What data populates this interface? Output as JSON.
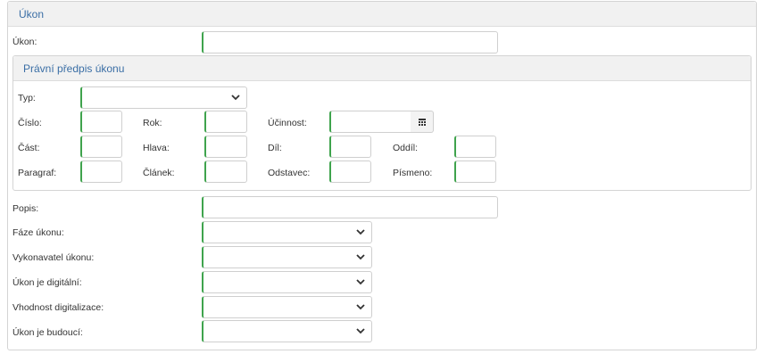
{
  "panel": {
    "title": "Úkon"
  },
  "ukon": {
    "label": "Úkon:",
    "value": ""
  },
  "pravni_predpis": {
    "title": "Právní předpis úkonu",
    "typ": {
      "label": "Typ:",
      "value": ""
    },
    "cislo": {
      "label": "Číslo:",
      "value": ""
    },
    "rok": {
      "label": "Rok:",
      "value": ""
    },
    "ucinnost": {
      "label": "Účinnost:",
      "value": ""
    },
    "cast": {
      "label": "Část:",
      "value": ""
    },
    "hlava": {
      "label": "Hlava:",
      "value": ""
    },
    "dil": {
      "label": "Díl:",
      "value": ""
    },
    "oddil": {
      "label": "Oddíl:",
      "value": ""
    },
    "paragraf": {
      "label": "Paragraf:",
      "value": ""
    },
    "clanek": {
      "label": "Článek:",
      "value": ""
    },
    "odstavec": {
      "label": "Odstavec:",
      "value": ""
    },
    "pismeno": {
      "label": "Písmeno:",
      "value": ""
    }
  },
  "popis": {
    "label": "Popis:",
    "value": ""
  },
  "faze": {
    "label": "Fáze úkonu:",
    "value": ""
  },
  "vykonavatel": {
    "label": "Vykonavatel úkonu:",
    "value": ""
  },
  "digitalni": {
    "label": "Úkon je digitální:",
    "value": ""
  },
  "vhodnost": {
    "label": "Vhodnost digitalizace:",
    "value": ""
  },
  "budouci": {
    "label": "Úkon je budoucí:",
    "value": ""
  },
  "icons": {
    "chevron": "chevron-down-icon",
    "calendar": "calendar-icon"
  },
  "colors": {
    "accent_border": "#3fa34d",
    "heading_text": "#3a6ea5"
  }
}
